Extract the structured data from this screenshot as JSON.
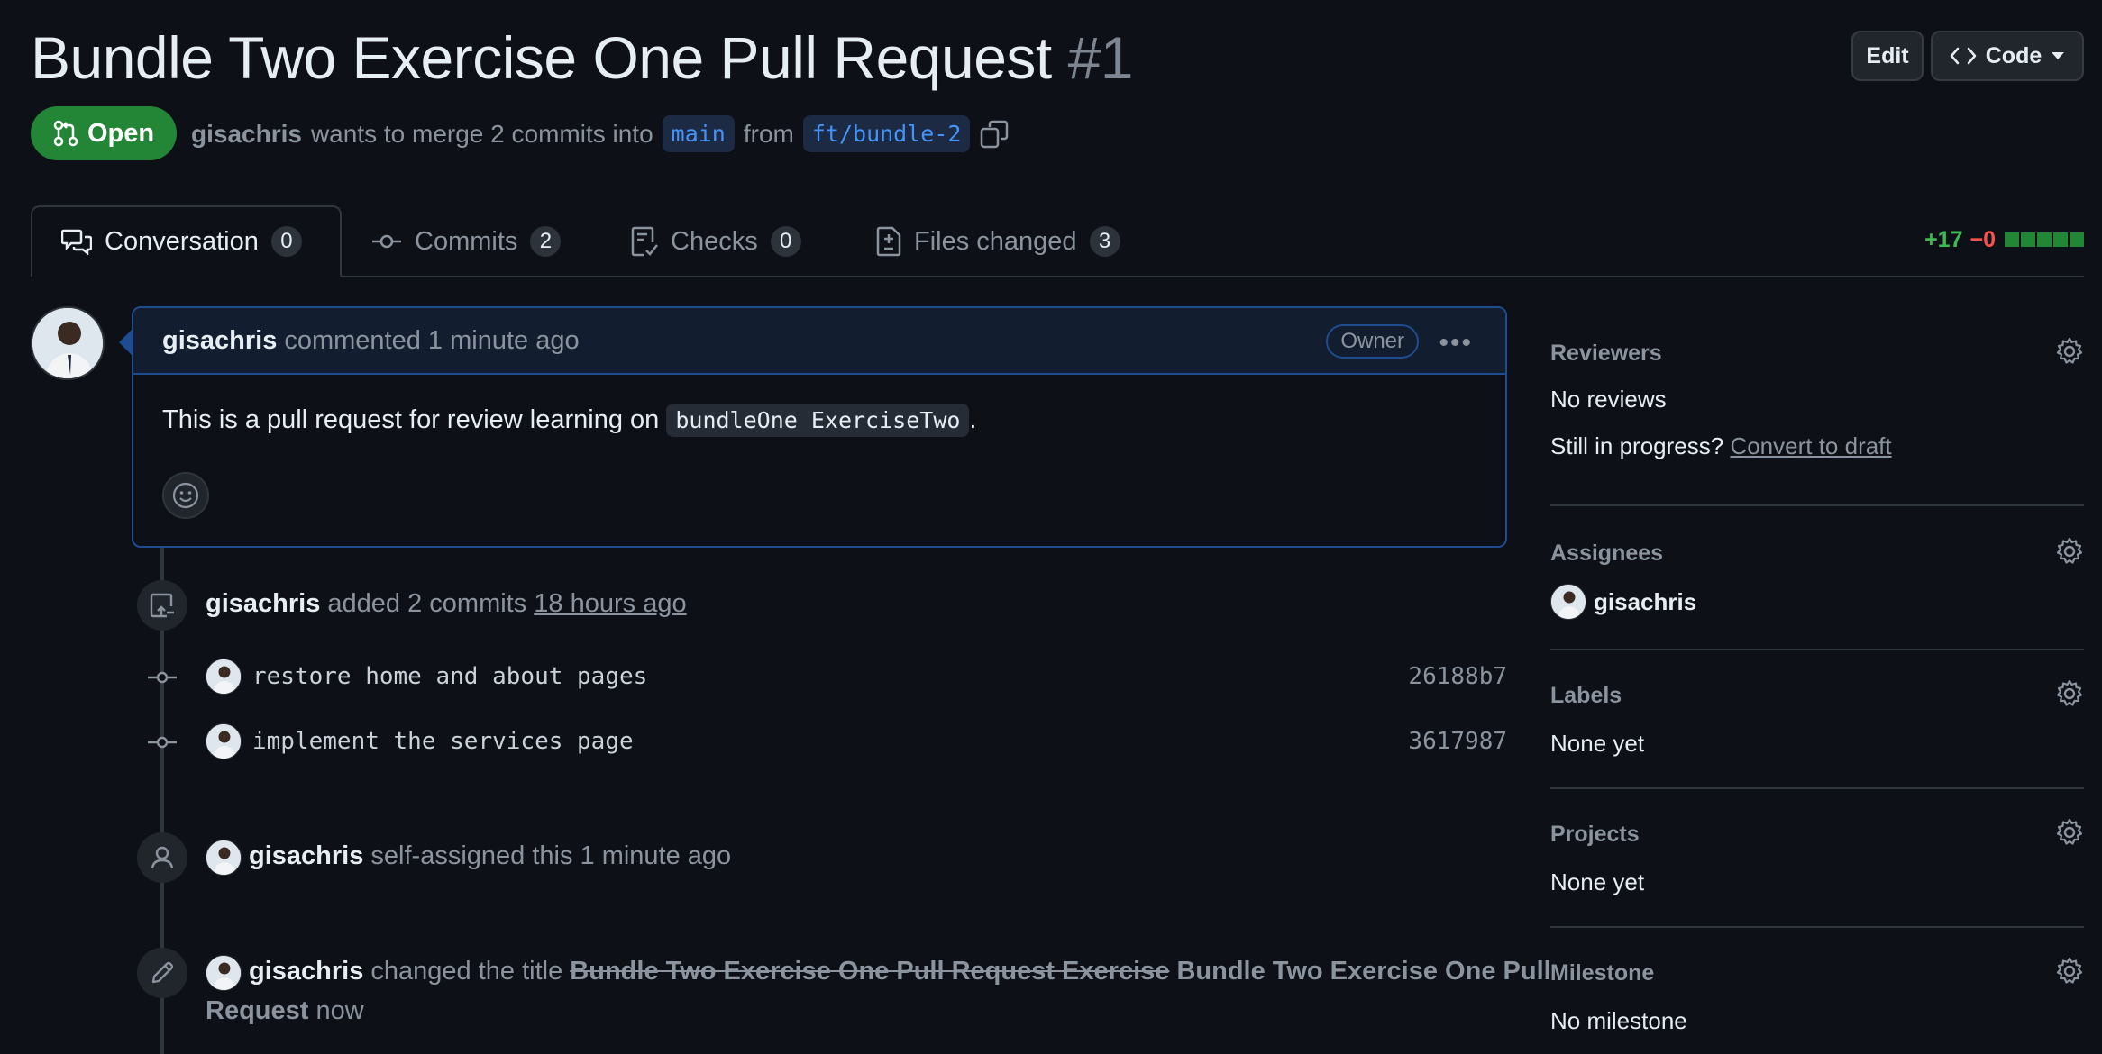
{
  "header": {
    "title": "Bundle Two Exercise One Pull Request",
    "number": "#1",
    "edit_label": "Edit",
    "code_label": "Code",
    "state": "Open",
    "author": "gisachris",
    "merge_text": "wants to merge 2 commits into",
    "base_branch": "main",
    "from_text": "from",
    "head_branch": "ft/bundle-2"
  },
  "tabs": [
    {
      "label": "Conversation",
      "count": "0"
    },
    {
      "label": "Commits",
      "count": "2"
    },
    {
      "label": "Checks",
      "count": "0"
    },
    {
      "label": "Files changed",
      "count": "3"
    }
  ],
  "diffstat": {
    "additions": "+17",
    "deletions": "−0"
  },
  "comment": {
    "author": "gisachris",
    "action": "commented 1 minute ago",
    "role_badge": "Owner",
    "body_prefix": "This is a pull request for review learning on",
    "body_code": "bundleOne ExerciseTwo",
    "body_suffix": "."
  },
  "timeline": {
    "commits_event": {
      "author": "gisachris",
      "text": "added 2 commits",
      "time": "18 hours ago"
    },
    "commits": [
      {
        "message": "restore home and about pages",
        "sha": "26188b7"
      },
      {
        "message": "implement the services page",
        "sha": "3617987"
      }
    ],
    "assign_event": {
      "author": "gisachris",
      "text": "self-assigned this 1 minute ago"
    },
    "rename_event": {
      "author": "gisachris",
      "text": "changed the title",
      "old_title": "Bundle Two Exercise One Pull Request Exercise",
      "new_title_line1": "Bundle Two Exercise One Pull",
      "new_title_line2": "Request",
      "time": "now"
    }
  },
  "sidebar": {
    "reviewers": {
      "title": "Reviewers",
      "value": "No reviews",
      "draft_prompt": "Still in progress?",
      "draft_link": "Convert to draft"
    },
    "assignees": {
      "title": "Assignees",
      "value": "gisachris"
    },
    "labels": {
      "title": "Labels",
      "value": "None yet"
    },
    "projects": {
      "title": "Projects",
      "value": "None yet"
    },
    "milestone": {
      "title": "Milestone",
      "value": "No milestone"
    }
  },
  "colors": {
    "open_green": "#238636",
    "accent_blue": "#4493f8",
    "background": "#0d1117"
  }
}
